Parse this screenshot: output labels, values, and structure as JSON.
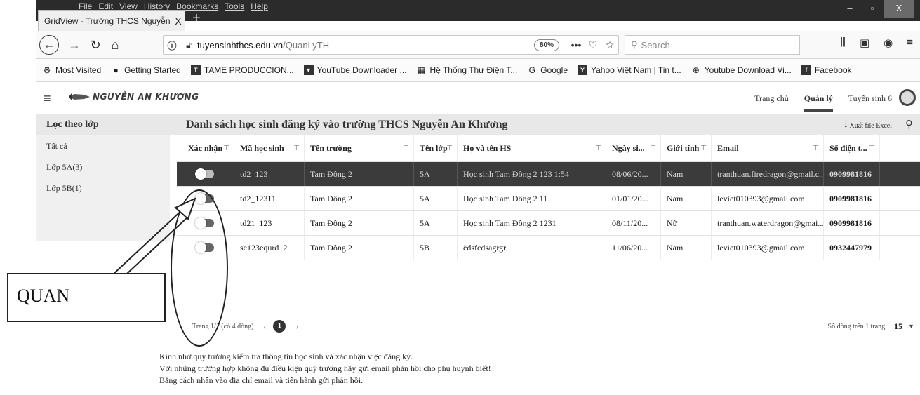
{
  "browser": {
    "menu": [
      "File",
      "Edit",
      "View",
      "History",
      "Bookmarks",
      "Tools",
      "Help"
    ],
    "tab_title": "GridView - Trường THCS Nguyễn A",
    "tab_close": "X",
    "new_tab": "+",
    "url_host": "tuyensinhthcs.edu.vn",
    "url_path": "/QuanLyTH",
    "zoom": "80%",
    "more": "•••",
    "search_placeholder": "Search",
    "win_minimize": "–",
    "win_maximize": "▫",
    "win_close": "X",
    "bookmarks": [
      {
        "label": "Most Visited",
        "icon": "gear-icon"
      },
      {
        "label": "Getting Started",
        "icon": "firefox-icon"
      },
      {
        "label": "TAME PRODUCCION...",
        "icon": "tame-icon"
      },
      {
        "label": "YouTube Downloader ...",
        "icon": "youtube-downloader-icon"
      },
      {
        "label": "Hệ Thống Thư Điện T...",
        "icon": "mail-system-icon"
      },
      {
        "label": "Google",
        "icon": "google-icon"
      },
      {
        "label": "Yahoo Việt Nam | Tin t...",
        "icon": "yahoo-icon"
      },
      {
        "label": "Youtube Download Vi...",
        "icon": "globe-icon"
      },
      {
        "label": "Facebook",
        "icon": "facebook-icon"
      }
    ]
  },
  "site": {
    "logo_text": "NGUYỄN AN KHƯƠNG",
    "nav": [
      "Trang chủ",
      "Quản lý",
      "Tuyển sinh 6"
    ],
    "filter_heading": "Lọc theo lớp",
    "page_title": "Danh sách học sinh đăng ký vào trường THCS Nguyễn An Khương",
    "export_label": "Xuất file Excel",
    "filters": [
      "Tất cả",
      "Lớp 5A(3)",
      "Lớp 5B(1)"
    ]
  },
  "grid": {
    "columns": [
      "Xác nhận",
      "Mã học sinh",
      "Tên trường",
      "Tên lớp",
      "Họ và tên HS",
      "Ngày si...",
      "Giới tính",
      "Email",
      "Số điện t..."
    ],
    "rows": [
      {
        "ma": "td2_123",
        "truong": "Tam Đông 2",
        "lop": "5A",
        "ten": "Học sinh Tam Đông 2 123 1:54",
        "ngay": "08/06/20...",
        "gioi": "Nam",
        "email": "tranthuan.firedragon@gmail.c...",
        "sdt": "0909981816"
      },
      {
        "ma": "td2_12311",
        "truong": "Tam Đông 2",
        "lop": "5A",
        "ten": "Học sinh Tam Đông 2 11",
        "ngay": "01/01/20...",
        "gioi": "Nam",
        "email": "leviet010393@gmail.com",
        "sdt": "0909981816"
      },
      {
        "ma": "td21_123",
        "truong": "Tam Đông 2",
        "lop": "5A",
        "ten": "Học sinh Tam Đông 2 1231",
        "ngay": "08/11/20...",
        "gioi": "Nữ",
        "email": "tranthuan.waterdragon@gmai...",
        "sdt": "0909981816"
      },
      {
        "ma": "se123equrd12",
        "truong": "Tam Đông 2",
        "lop": "5B",
        "ten": "èdsfcdsagrgr",
        "ngay": "11/06/20...",
        "gioi": "Nam",
        "email": "leviet010393@gmail.com",
        "sdt": "0932447979"
      }
    ],
    "pager_info": "Trang 1/1 (có 4 dòng)",
    "pager_prev": "‹",
    "pager_page": "1",
    "pager_next": "›",
    "rows_per_page_label": "Số dòng trên 1 trang:",
    "rows_per_page": "15",
    "dropdown": "▾"
  },
  "note": [
    "Kính nhờ quý trường kiểm tra thông tin học sinh và xác nhận việc đăng ký.",
    "Với những trường hợp không đủ điều kiện quý trường hãy gửi email phản hồi cho phụ huynh biết!",
    "Bằng cách nhấn vào địa chỉ email và tiến hành gửi phản hồi."
  ],
  "annotation": {
    "label": "QUAN"
  },
  "colors": {
    "selected_row": "#3b3b3b",
    "header_band": "#e8e8e8",
    "titlebar": "#2b2b2b"
  }
}
